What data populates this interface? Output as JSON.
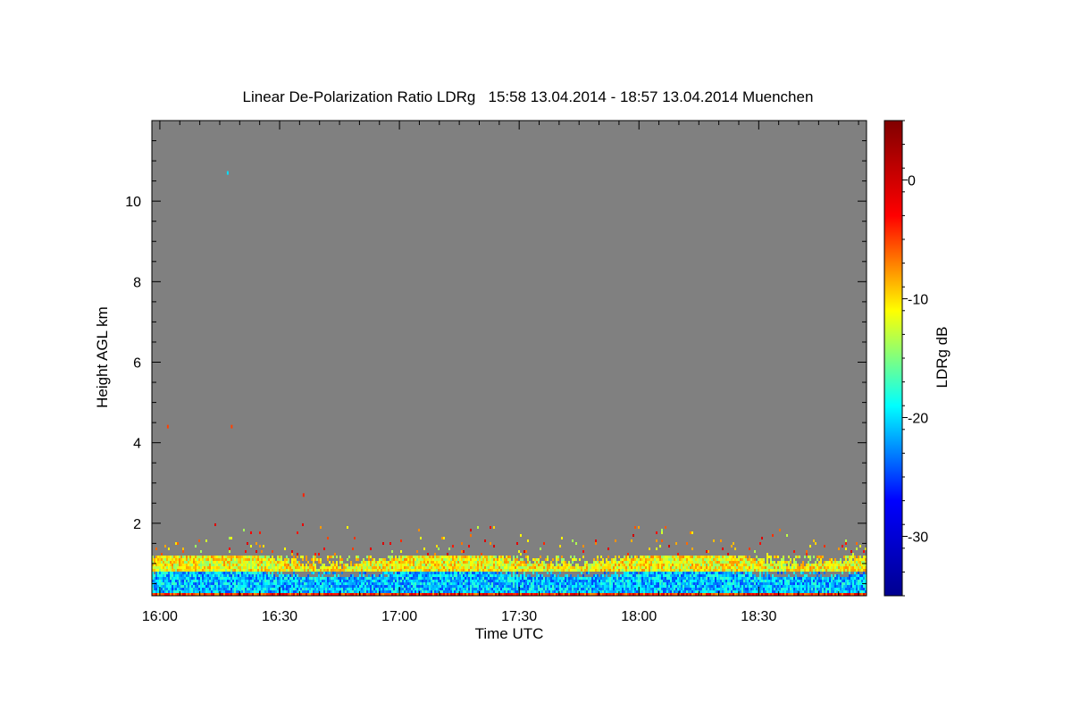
{
  "chart_data": {
    "type": "heatmap",
    "title": "Linear De-Polarization Ratio LDRg   15:58 13.04.2014 - 18:57 13.04.2014 Muenchen",
    "xlabel": "Time UTC",
    "ylabel": "Height AGL km",
    "colorbar_label": "LDRg dB",
    "x_range_minutes_utc": [
      958,
      1137
    ],
    "y_range_km": [
      0.2,
      12.0
    ],
    "x_ticks": [
      {
        "value": 960,
        "label": "16:00"
      },
      {
        "value": 990,
        "label": "16:30"
      },
      {
        "value": 1020,
        "label": "17:00"
      },
      {
        "value": 1050,
        "label": "17:30"
      },
      {
        "value": 1080,
        "label": "18:00"
      },
      {
        "value": 1110,
        "label": "18:30"
      }
    ],
    "y_ticks": [
      {
        "value": 2,
        "label": "2"
      },
      {
        "value": 4,
        "label": "4"
      },
      {
        "value": 6,
        "label": "6"
      },
      {
        "value": 8,
        "label": "8"
      },
      {
        "value": 10,
        "label": "10"
      }
    ],
    "colorbar_range_db": [
      -35,
      5
    ],
    "colorbar_ticks": [
      {
        "value": 0,
        "label": "0"
      },
      {
        "value": -10,
        "label": "-10"
      },
      {
        "value": -20,
        "label": "-20"
      },
      {
        "value": -30,
        "label": "-30"
      }
    ],
    "colormap": [
      "#00008f",
      "#0000ff",
      "#00ffff",
      "#ffff00",
      "#ff0000",
      "#800000"
    ],
    "background_color": "#808080",
    "layers": [
      {
        "height_km": [
          0.2,
          0.3
        ],
        "ldr_db_mean": -4,
        "note_color": "red"
      },
      {
        "height_km": [
          0.3,
          0.8
        ],
        "ldr_db_mean": -21
      },
      {
        "height_km": [
          0.8,
          1.2
        ],
        "ldr_db_mean": -11
      },
      {
        "height_km": [
          1.2,
          2.0
        ],
        "ldr_db_mean": -7,
        "sparse": true
      }
    ],
    "isolated_points": [
      {
        "time_min": 977,
        "height_km": 10.7,
        "ldr_db": -20
      },
      {
        "time_min": 962,
        "height_km": 4.4,
        "ldr_db": -5
      },
      {
        "time_min": 978,
        "height_km": 4.4,
        "ldr_db": -5
      },
      {
        "time_min": 996,
        "height_km": 2.7,
        "ldr_db": -4
      }
    ]
  }
}
